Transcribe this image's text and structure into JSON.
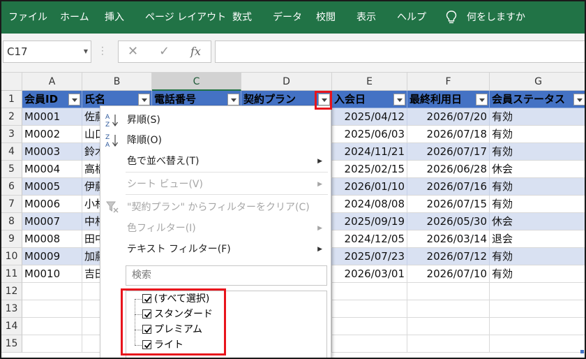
{
  "ribbon": {
    "tabs": [
      "ファイル",
      "ホーム",
      "挿入",
      "ページ レイアウト",
      "数式",
      "データ",
      "校閲",
      "表示",
      "ヘルプ"
    ],
    "tell_me": "何をしますか",
    "bg": "#217346"
  },
  "formula_bar": {
    "name_box": "C17",
    "cancel_icon": "✕",
    "enter_icon": "✓",
    "fx": "fx",
    "value": ""
  },
  "grid": {
    "columns": [
      "A",
      "B",
      "C",
      "D",
      "E",
      "F",
      "G"
    ],
    "selected_column": "C",
    "rows": [
      "1",
      "2",
      "3",
      "4",
      "5",
      "6",
      "7",
      "8",
      "9",
      "10",
      "11",
      "12",
      "13",
      "14",
      "15"
    ],
    "header_fields": [
      "会員ID",
      "氏名",
      "電話番号",
      "契約プラン",
      "入会日",
      "最終利用日",
      "会員ステータス"
    ],
    "data": [
      {
        "id": "M0001",
        "name": "佐藤",
        "join": "2025/04/12",
        "last": "2026/07/20",
        "status": "有効"
      },
      {
        "id": "M0002",
        "name": "山口",
        "join": "2025/06/03",
        "last": "2026/07/18",
        "status": "有効"
      },
      {
        "id": "M0003",
        "name": "鈴木",
        "join": "2024/11/21",
        "last": "2026/07/17",
        "status": "有効"
      },
      {
        "id": "M0004",
        "name": "高橋",
        "join": "2025/02/15",
        "last": "2026/06/28",
        "status": "休会"
      },
      {
        "id": "M0005",
        "name": "伊藤",
        "join": "2026/01/10",
        "last": "2026/07/16",
        "status": "有効"
      },
      {
        "id": "M0006",
        "name": "小林",
        "join": "2024/08/08",
        "last": "2026/07/15",
        "status": "有効"
      },
      {
        "id": "M0007",
        "name": "中村",
        "join": "2025/09/19",
        "last": "2026/05/30",
        "status": "休会"
      },
      {
        "id": "M0008",
        "name": "田中",
        "join": "2024/12/05",
        "last": "2026/03/14",
        "status": "退会"
      },
      {
        "id": "M0009",
        "name": "加藤",
        "join": "2025/07/23",
        "last": "2026/07/12",
        "status": "有効"
      },
      {
        "id": "M0010",
        "name": "吉田",
        "join": "2026/03/01",
        "last": "2026/07/10",
        "status": "有効"
      }
    ],
    "header_color": "#4472c4",
    "band_color": "#d9e1f2"
  },
  "filter_menu": {
    "sort_asc": "昇順(S)",
    "sort_desc": "降順(O)",
    "sort_by_color": "色で並べ替え(T)",
    "sheet_view": "シート ビュー(V)",
    "clear_filter": "\"契約プラン\" からフィルターをクリア(C)",
    "color_filter": "色フィルター(I)",
    "text_filter": "テキスト フィルター(F)",
    "search_placeholder": "検索",
    "items": [
      "(すべて選択)",
      "スタンダード",
      "プレミアム",
      "ライト"
    ],
    "highlight_color": "#e8141c"
  }
}
